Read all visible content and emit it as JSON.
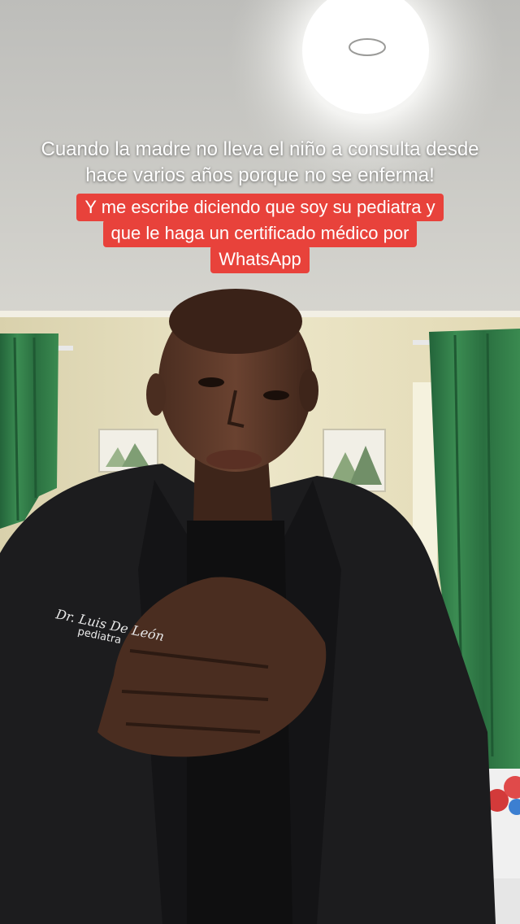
{
  "caption_top": "Cuando la madre no lleva el niño a consulta desde hace varios años porque no se enferma!",
  "caption_highlight_lines": [
    "Y me escribe diciendo que soy su pediatra y",
    "que le haga un certificado médico por",
    "WhatsApp"
  ],
  "jacket_embroidery": {
    "name": "Dr. Luis De León",
    "role": "pediatra"
  },
  "colors": {
    "caption_highlight": "#e8423b",
    "curtain": "#2f7a45",
    "wall": "#e9e2c2",
    "ceiling": "#cfcfcb",
    "jacket": "#1c1c1e"
  }
}
